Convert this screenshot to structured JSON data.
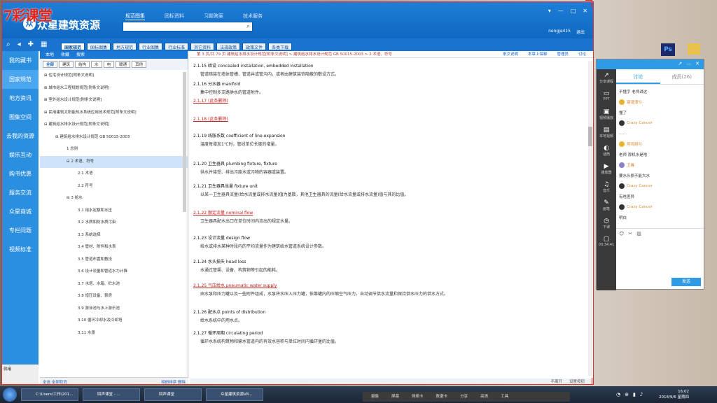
{
  "brand": "7彩课堂",
  "app": {
    "logo": "众星建筑资源",
    "top_tabs": [
      "规范图集",
      "团标资料",
      "习题答案",
      "技术服务"
    ],
    "search_placeholder": "",
    "user_name": "nengje415",
    "logout": "退出",
    "win_controls": [
      "▾",
      "—",
      "□",
      "✕"
    ]
  },
  "toolbar": {
    "tabs": [
      "国家规范",
      "国标图集",
      "地方规范",
      "行业图集",
      "行业标准",
      "其它资料",
      "法规政策",
      "政策文件",
      "各类下载"
    ],
    "icons": [
      "search-icon",
      "back-icon",
      "add-icon",
      "grid-icon"
    ]
  },
  "leftnav": [
    "我的藏书",
    "国家规范",
    "地方资讯",
    "图集空间",
    "去我的资源",
    "娱乐互动",
    "购书优惠",
    "服务交流",
    "众星商城",
    "专栏问题",
    "视频标准"
  ],
  "tree": {
    "toolbar": [
      "本地",
      "收藏",
      "搜索"
    ],
    "tabs": [
      "全部",
      "建筑",
      "结构",
      "水",
      "电",
      "暖通",
      "其他"
    ],
    "nodes": [
      {
        "indent": 0,
        "text": "⊞ 住宅设计规范[附条文说明]"
      },
      {
        "indent": 0,
        "text": "⊞ 城市给水工程规划规范[附条文说明]"
      },
      {
        "indent": 0,
        "text": "⊞ 室外给水设计规范[附条文说明]"
      },
      {
        "indent": 0,
        "text": "⊞ 民用建筑太阳能热水系统应用技术规范[附条文说明]"
      },
      {
        "indent": 0,
        "text": "⊟ 建筑给水排水设计规范[附条文说明]"
      },
      {
        "indent": 1,
        "text": "⊟ 建筑给水排水设计规范 GB 50015-2003"
      },
      {
        "indent": 2,
        "text": "1 总则"
      },
      {
        "indent": 2,
        "text": "⊟ 2 术语、符号",
        "sel": true
      },
      {
        "indent": 3,
        "text": "2.1 术语"
      },
      {
        "indent": 3,
        "text": "2.2 符号"
      },
      {
        "indent": 2,
        "text": "⊟ 3 给水"
      },
      {
        "indent": 3,
        "text": "3.1 用水定额和水压"
      },
      {
        "indent": 3,
        "text": "3.2 水质和防水质污染"
      },
      {
        "indent": 3,
        "text": "3.3 系统选择"
      },
      {
        "indent": 3,
        "text": "3.4 管材、附件和水表"
      },
      {
        "indent": 3,
        "text": "3.5 管道布置和敷设"
      },
      {
        "indent": 3,
        "text": "3.6 设计流量和管道水力计算"
      },
      {
        "indent": 3,
        "text": "3.7 水塔、水箱、贮水池"
      },
      {
        "indent": 3,
        "text": "3.8 增压设备、泵房"
      },
      {
        "indent": 3,
        "text": "3.9 游泳池与水上游乐池"
      },
      {
        "indent": 3,
        "text": "3.10 循环冷却水及冷却塔"
      },
      {
        "indent": 3,
        "text": "3.11 水景"
      }
    ],
    "foot_left": "全选  全部取消",
    "foot_right": "相册排序  删除"
  },
  "content": {
    "breadcrumb": "第 3 页/共 79 页   建筑给水排水设计规范[附条文说明] > 建筑给水排水设计规范 GB 50015-2003 > 2 术语、符号",
    "actions": [
      "条文说明",
      "本章上保释",
      "管理员",
      "讨论"
    ],
    "terms": [
      {
        "head": "2.1.15 暗设  concealed installation, embedded installation",
        "desc": "管道暗装在墙体管槽、管道井或管沟内，或者由建筑装饰隐蔽的敷设方式。",
        "red": false
      },
      {
        "head": "2.1.16 分水器  manifold",
        "desc": "集中控制多支路供水的管道附件。",
        "red": false
      },
      {
        "head": "2.1.17 (此条删除)",
        "desc": "",
        "red": true
      },
      {
        "head": "2.1.18 (此条删除)",
        "desc": "",
        "red": true
      },
      {
        "head": "2.1.19 线胀系数  coefficient of line-expansion",
        "desc": "温度每增加1℃时，管线单位长度的增量。",
        "red": false
      },
      {
        "head": "2.1.20 卫生器具  plumbing fixture, fixture",
        "desc": "供水并接受、排出污废水或污物的容器或装置。",
        "red": false
      },
      {
        "head": "2.1.21 卫生器具当量  fixture unit",
        "desc": "以某一卫生器具流量(给水流量或排水流量)值为基数，其他卫生器具的流量(给水流量或排水流量)值与其的比值。",
        "red": false
      },
      {
        "head": "2.1.22 额定流量  nominal flow",
        "desc": "卫生器具配水出口在单位时间内流出的规定水量。",
        "red": true
      },
      {
        "head": "2.1.23 设计流量  design flow",
        "desc": "给水或排水某种时段内的平均流量作为建筑给水管道系统设计参数。",
        "red": false
      },
      {
        "head": "2.1.24 水头损失  head loss",
        "desc": "水通过管渠、设备、构筑物等引起的能耗。",
        "red": false
      },
      {
        "head": "2.1.25 气压给水  pneumatic water supply",
        "desc": "由水泵和压力罐以及一些附件组成，水泵将水压入压力罐，依靠罐内的压缩空气压力，自动调节供水流量和保持供水压力的供水方式。",
        "red": true
      },
      {
        "head": "2.1.26 配水点  points of distribution",
        "desc": "给水系统中的用水点。",
        "red": false
      },
      {
        "head": "2.1.27 循环周期  circulating period",
        "desc": "循环水系统构筑物和输水管道内的有效水容积与单位时间内循环量的比值。",
        "red": false
      }
    ],
    "foot": [
      "不离开",
      "设置按钮"
    ]
  },
  "statusbar": "就绪",
  "chat": {
    "head_icons": [
      "↗",
      "—",
      "✕"
    ],
    "side": [
      {
        "icon": "↗",
        "label": "分享课程"
      },
      {
        "icon": "▭",
        "label": "PPT"
      },
      {
        "icon": "▣",
        "label": "视频播放"
      },
      {
        "icon": "▤",
        "label": "本地视频"
      },
      {
        "icon": "◐",
        "label": "话筒"
      },
      {
        "icon": "▶",
        "label": "播放器"
      },
      {
        "icon": "♫",
        "label": "音乐"
      },
      {
        "icon": "✎",
        "label": "画笔"
      },
      {
        "icon": "◷",
        "label": "下课"
      },
      {
        "icon": "▢",
        "label": "00:34:41"
      }
    ],
    "tabs": [
      "讨论",
      "成员(26)"
    ],
    "messages": [
      {
        "type": "text",
        "text": "不懂字 老师讲这"
      },
      {
        "type": "name",
        "text": "路漫漫兮",
        "av": "y"
      },
      {
        "type": "text",
        "text": "懂了"
      },
      {
        "type": "name",
        "text": "Crazy Cancer",
        "av": "d"
      },
      {
        "type": "text",
        "text": "……"
      },
      {
        "type": "name",
        "text": "阿鸡翔兮",
        "av": "y"
      },
      {
        "type": "text",
        "text": "老师 那机水是啥"
      },
      {
        "type": "name",
        "text": "卫峰",
        "av": "p"
      },
      {
        "type": "text",
        "text": "要水头损不能大水"
      },
      {
        "type": "name",
        "text": "Crazy Cancer",
        "av": "d"
      },
      {
        "type": "text",
        "text": "有啥差异"
      },
      {
        "type": "name",
        "text": "Crazy Cancer",
        "av": "d"
      },
      {
        "type": "text",
        "text": "明白"
      }
    ],
    "input_icons": [
      "smile-icon",
      "scissors-icon",
      "image-icon"
    ],
    "send": "发送"
  },
  "desktop": {
    "ps": "Ps"
  },
  "taskbar": {
    "items": [
      "C:\\Users\\工作\\201...",
      "回声课堂 - ...",
      "回声课堂",
      "众星建筑资源V8..."
    ],
    "media": [
      "摄像",
      "屏幕",
      "网络卡",
      "数据卡",
      "分享",
      "高清",
      "工具"
    ],
    "time": "16:02",
    "date": "2018/9/6 星期四"
  }
}
